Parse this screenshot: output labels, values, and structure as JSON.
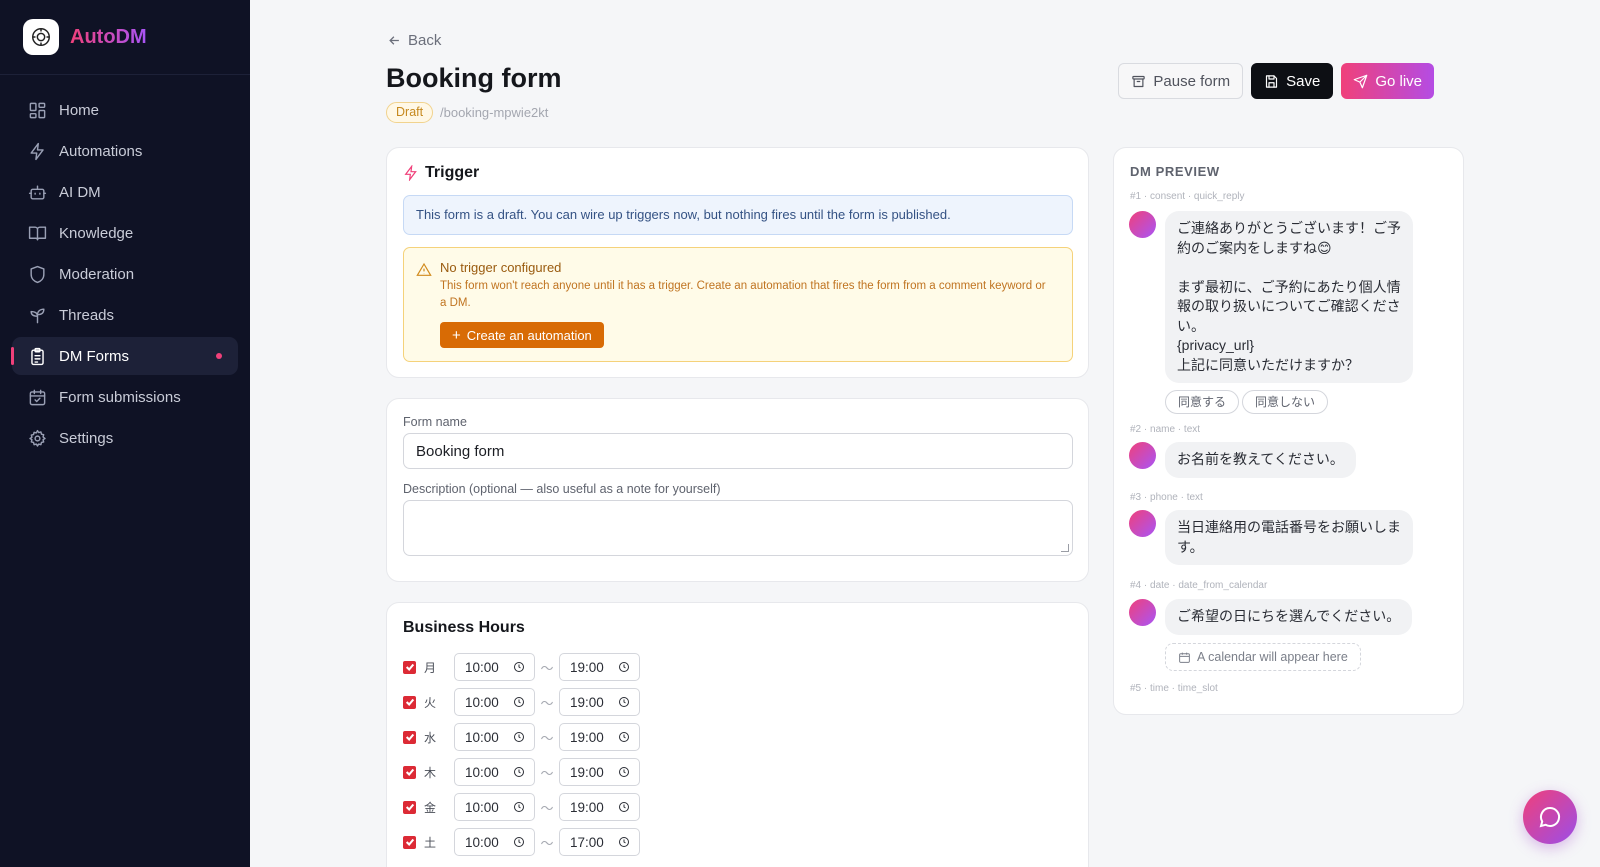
{
  "brand": {
    "name": "AutoDM"
  },
  "sidebar": {
    "items": [
      {
        "label": "Home",
        "icon": "grid-icon"
      },
      {
        "label": "Automations",
        "icon": "bolt-icon"
      },
      {
        "label": "AI DM",
        "icon": "robot-icon"
      },
      {
        "label": "Knowledge",
        "icon": "book-icon"
      },
      {
        "label": "Moderation",
        "icon": "shield-icon"
      },
      {
        "label": "Threads",
        "icon": "sprout-icon"
      },
      {
        "label": "DM Forms",
        "icon": "clipboard-icon",
        "active": true
      },
      {
        "label": "Form submissions",
        "icon": "calendar-check-icon"
      },
      {
        "label": "Settings",
        "icon": "gear-icon"
      }
    ]
  },
  "header": {
    "back_label": "Back",
    "title": "Booking form",
    "status": "Draft",
    "slug": "/booking-mpwie2kt",
    "pause_label": "Pause form",
    "save_label": "Save",
    "golive_label": "Go live"
  },
  "trigger": {
    "title": "Trigger",
    "info": "This form is a draft. You can wire up triggers now, but nothing fires until the form is published.",
    "warn_title": "No trigger configured",
    "warn_text": "This form won't reach anyone until it has a trigger. Create an automation that fires the form from a comment keyword or a DM.",
    "create_label": "Create an automation"
  },
  "form": {
    "name_label": "Form name",
    "name_value": "Booking form",
    "desc_label": "Description (optional — also useful as a note for yourself)",
    "desc_value": ""
  },
  "hours": {
    "title": "Business Hours",
    "rows": [
      {
        "day": "月",
        "start": "10:00",
        "end": "19:00",
        "enabled": true
      },
      {
        "day": "火",
        "start": "10:00",
        "end": "19:00",
        "enabled": true
      },
      {
        "day": "水",
        "start": "10:00",
        "end": "19:00",
        "enabled": true
      },
      {
        "day": "木",
        "start": "10:00",
        "end": "19:00",
        "enabled": true
      },
      {
        "day": "金",
        "start": "10:00",
        "end": "19:00",
        "enabled": true
      },
      {
        "day": "土",
        "start": "10:00",
        "end": "17:00",
        "enabled": true
      }
    ],
    "separator": "〜"
  },
  "preview": {
    "title": "DM PREVIEW",
    "steps": [
      {
        "meta": "#1 · consent · quick_reply",
        "lines": [
          "ご連絡ありがとうございます！ご予",
          "約のご案内をしますね😊",
          "",
          "まず最初に、ご予約にあたり個人情",
          "報の取り扱いについてご確認くださ",
          "い。",
          "{privacy_url}",
          "上記に同意いただけますか？"
        ],
        "chips": [
          "同意する",
          "同意しない"
        ]
      },
      {
        "meta": "#2 · name · text",
        "lines": [
          "お名前を教えてください。"
        ]
      },
      {
        "meta": "#3 · phone · text",
        "lines": [
          "当日連絡用の電話番号をお願いしま",
          "す。"
        ]
      },
      {
        "meta": "#4 · date · date_from_calendar",
        "lines": [
          "ご希望の日にちを選んでください。"
        ],
        "calendar_note": "A calendar will appear here"
      },
      {
        "meta": "#5 · time · time_slot"
      }
    ]
  },
  "colors": {
    "accent": "#f0407a",
    "sidebar_bg": "#0f1225",
    "warn_button": "#d86b05",
    "checkbox": "#dc2a35"
  }
}
